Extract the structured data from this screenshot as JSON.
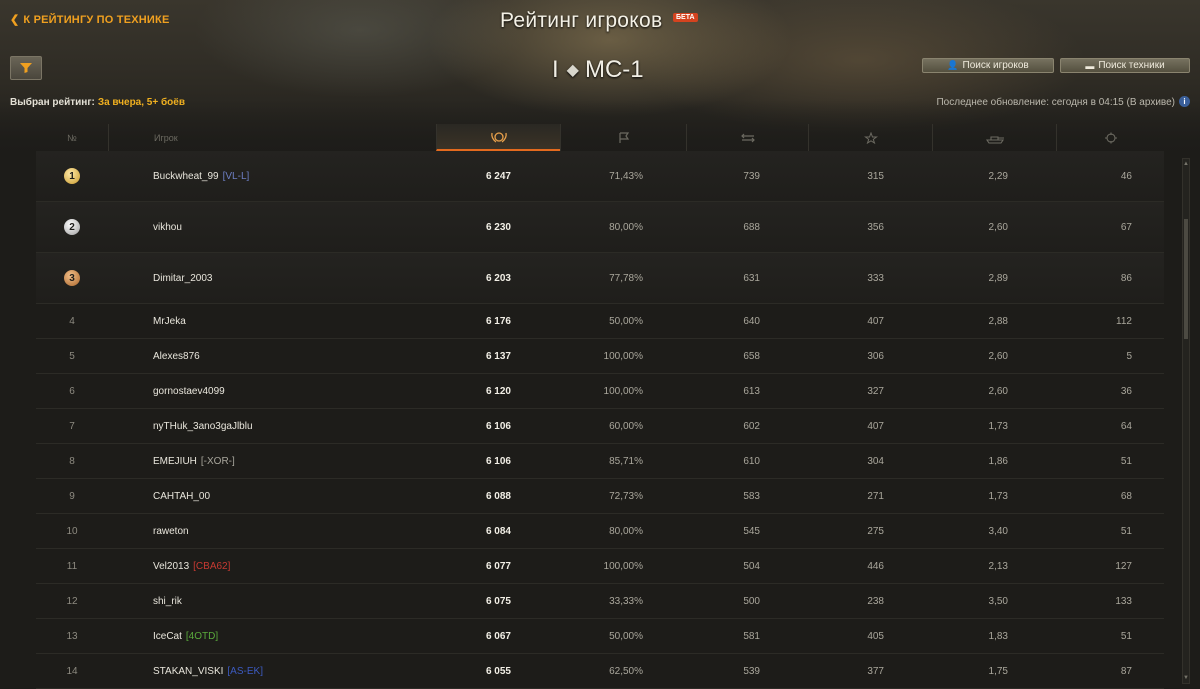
{
  "header": {
    "back_link": "К РЕЙТИНГУ ПО ТЕХНИКЕ",
    "title": "Рейтинг игроков",
    "beta_badge": "БЕТА"
  },
  "vehicle": {
    "tier": "I",
    "type_icon": "light-tank-icon",
    "name": "МС-1"
  },
  "buttons": {
    "find_players": "Поиск игроков",
    "find_vehicles": "Поиск техники"
  },
  "rating_info": {
    "selected_label": "Выбран рейтинг:",
    "selected_value": "За вчера, 5+ боёв",
    "last_update": "Последнее обновление: сегодня в 04:15 (В архиве)"
  },
  "table": {
    "headers": {
      "rank": "№",
      "player": "Игрок"
    },
    "column_icons": [
      "rating-laurel-icon",
      "win-flag-icon",
      "battles-icon",
      "xp-star-icon",
      "damage-tank-icon",
      "frags-icon"
    ],
    "rows": [
      {
        "rank": "1",
        "medal": "gold",
        "player": "Buckwheat_99",
        "clan": "[VL-L]",
        "clan_color": "#6d7fc4",
        "score": "6 247",
        "win": "71,43%",
        "battles": "739",
        "xp": "315",
        "dmg": "2,29",
        "frags": "46"
      },
      {
        "rank": "2",
        "medal": "silver",
        "player": "vikhou",
        "clan": "",
        "clan_color": "",
        "score": "6 230",
        "win": "80,00%",
        "battles": "688",
        "xp": "356",
        "dmg": "2,60",
        "frags": "67"
      },
      {
        "rank": "3",
        "medal": "bronze",
        "player": "Dimitar_2003",
        "clan": "",
        "clan_color": "",
        "score": "6 203",
        "win": "77,78%",
        "battles": "631",
        "xp": "333",
        "dmg": "2,89",
        "frags": "86"
      },
      {
        "rank": "4",
        "medal": "",
        "player": "MrJeka",
        "clan": "",
        "clan_color": "",
        "score": "6 176",
        "win": "50,00%",
        "battles": "640",
        "xp": "407",
        "dmg": "2,88",
        "frags": "112"
      },
      {
        "rank": "5",
        "medal": "",
        "player": "Alexes876",
        "clan": "",
        "clan_color": "",
        "score": "6 137",
        "win": "100,00%",
        "battles": "658",
        "xp": "306",
        "dmg": "2,60",
        "frags": "5"
      },
      {
        "rank": "6",
        "medal": "",
        "player": "gornostaev4099",
        "clan": "",
        "clan_color": "",
        "score": "6 120",
        "win": "100,00%",
        "battles": "613",
        "xp": "327",
        "dmg": "2,60",
        "frags": "36"
      },
      {
        "rank": "7",
        "medal": "",
        "player": "nyTHuk_3ano3gaJlblu",
        "clan": "",
        "clan_color": "",
        "score": "6 106",
        "win": "60,00%",
        "battles": "602",
        "xp": "407",
        "dmg": "1,73",
        "frags": "64"
      },
      {
        "rank": "8",
        "medal": "",
        "player": "EMEJIUH",
        "clan": "[-XOR-]",
        "clan_color": "#a8a69c",
        "score": "6 106",
        "win": "85,71%",
        "battles": "610",
        "xp": "304",
        "dmg": "1,86",
        "frags": "51"
      },
      {
        "rank": "9",
        "medal": "",
        "player": "CAHTAH_00",
        "clan": "",
        "clan_color": "",
        "score": "6 088",
        "win": "72,73%",
        "battles": "583",
        "xp": "271",
        "dmg": "1,73",
        "frags": "68"
      },
      {
        "rank": "10",
        "medal": "",
        "player": "raweton",
        "clan": "",
        "clan_color": "",
        "score": "6 084",
        "win": "80,00%",
        "battles": "545",
        "xp": "275",
        "dmg": "3,40",
        "frags": "51"
      },
      {
        "rank": "11",
        "medal": "",
        "player": "Vel2013",
        "clan": "[CBA62]",
        "clan_color": "#c83a32",
        "score": "6 077",
        "win": "100,00%",
        "battles": "504",
        "xp": "446",
        "dmg": "2,13",
        "frags": "127"
      },
      {
        "rank": "12",
        "medal": "",
        "player": "shi_rik",
        "clan": "",
        "clan_color": "",
        "score": "6 075",
        "win": "33,33%",
        "battles": "500",
        "xp": "238",
        "dmg": "3,50",
        "frags": "133"
      },
      {
        "rank": "13",
        "medal": "",
        "player": "IceCat",
        "clan": "[4OTD]",
        "clan_color": "#5aaa3c",
        "score": "6 067",
        "win": "50,00%",
        "battles": "581",
        "xp": "405",
        "dmg": "1,83",
        "frags": "51"
      },
      {
        "rank": "14",
        "medal": "",
        "player": "STAKAN_VISKI",
        "clan": "[AS-EK]",
        "clan_color": "#3c5ac0",
        "score": "6 055",
        "win": "62,50%",
        "battles": "539",
        "xp": "377",
        "dmg": "1,75",
        "frags": "87"
      }
    ]
  },
  "colors": {
    "accent_orange": "#f0a020",
    "active_column_underline": "#e46a1e",
    "beta_red": "#d4431f"
  }
}
